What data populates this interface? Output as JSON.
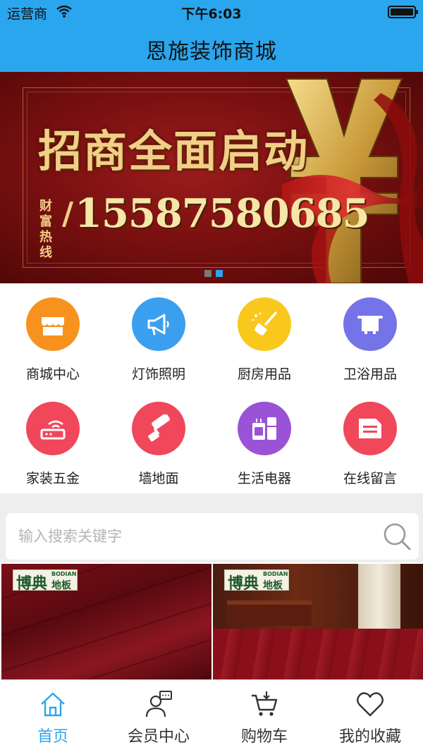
{
  "status_bar": {
    "carrier": "运营商",
    "time": "下午6:03"
  },
  "nav": {
    "title": "恩施装饰商城"
  },
  "banner": {
    "headline": "招商全面启动",
    "hotline_label": "财富热线",
    "hotline_number": "15587580685",
    "page_count": 2,
    "active_page": 2
  },
  "categories": [
    {
      "label": "商城中心",
      "icon": "store-icon",
      "color": "#f7921e"
    },
    {
      "label": "灯饰照明",
      "icon": "megaphone-icon",
      "color": "#3b9ff0"
    },
    {
      "label": "厨房用品",
      "icon": "broom-icon",
      "color": "#f9c81c"
    },
    {
      "label": "卫浴用品",
      "icon": "towel-rack-icon",
      "color": "#7474e8"
    },
    {
      "label": "家装五金",
      "icon": "router-icon",
      "color": "#f0475a"
    },
    {
      "label": "墙地面",
      "icon": "paint-roller-icon",
      "color": "#f0475a"
    },
    {
      "label": "生活电器",
      "icon": "appliance-icon",
      "color": "#9a52d6"
    },
    {
      "label": "在线留言",
      "icon": "message-icon",
      "color": "#f0475a"
    }
  ],
  "search": {
    "placeholder": "输入搜索关键字",
    "value": ""
  },
  "products": [
    {
      "brand": "博典",
      "brand_en": "BODIAN",
      "brand_sub": "地板"
    },
    {
      "brand": "博典",
      "brand_en": "BODIAN",
      "brand_sub": "地板"
    }
  ],
  "tabbar": {
    "active_index": 0,
    "active_color": "#2aa6ee",
    "items": [
      {
        "label": "首页",
        "icon": "home-icon"
      },
      {
        "label": "会员中心",
        "icon": "member-icon"
      },
      {
        "label": "购物车",
        "icon": "cart-icon"
      },
      {
        "label": "我的收藏",
        "icon": "heart-icon"
      }
    ]
  }
}
